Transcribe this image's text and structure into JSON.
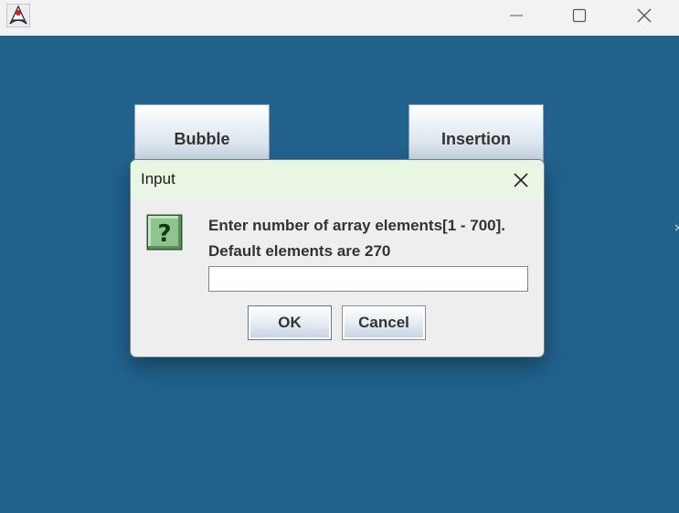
{
  "window": {
    "app_icon": "java-duke-icon",
    "controls": [
      "minimize-icon",
      "maximize-icon",
      "close-icon"
    ]
  },
  "main": {
    "buttons": [
      {
        "label": "Bubble"
      },
      {
        "label": "Insertion"
      }
    ],
    "background_color": "#22628d"
  },
  "dialog": {
    "title": "Input",
    "icon": "question-icon",
    "message_line1": "Enter number of array elements[1 - 700].",
    "message_line2": "Default elements are 270",
    "input_value": "",
    "ok_label": "OK",
    "cancel_label": "Cancel",
    "titlebar_color": "#eaf6e4"
  }
}
